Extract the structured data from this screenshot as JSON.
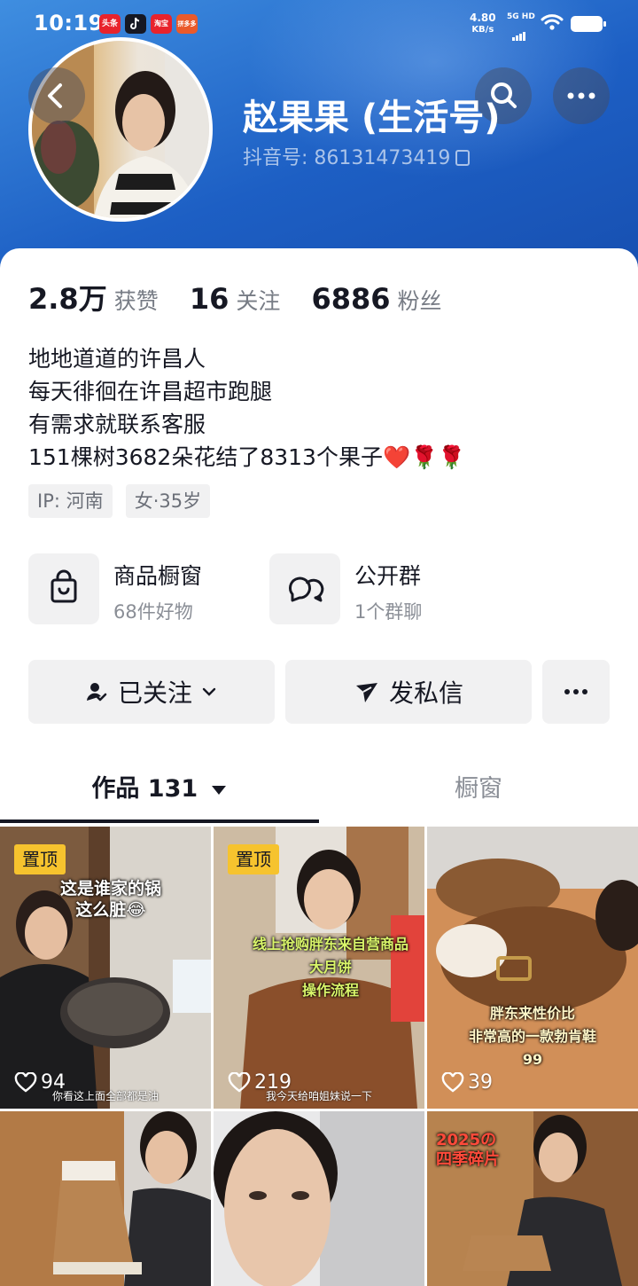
{
  "status_bar": {
    "time": "10:19",
    "apps": [
      "头条",
      "抖音",
      "淘宝",
      "拼多多"
    ],
    "net_speed": "4.80",
    "net_unit": "KB/s",
    "network": "5G HD"
  },
  "profile": {
    "name": "赵果果 (生活号)",
    "douyin_id": "抖音号: 86131473419",
    "stats": [
      {
        "value": "2.8万",
        "label": "获赞"
      },
      {
        "value": "16",
        "label": "关注"
      },
      {
        "value": "6886",
        "label": "粉丝"
      }
    ],
    "bio": [
      "地地道道的许昌人",
      "每天徘徊在许昌超市跑腿",
      "有需求就联系客服",
      "151棵树3682朵花结了8313个果子❤️🌹🌹"
    ],
    "tags": [
      "IP: 河南",
      "女·35岁"
    ]
  },
  "features": [
    {
      "title": "商品橱窗",
      "subtitle": "68件好物",
      "icon": "shopping-bag-icon"
    },
    {
      "title": "公开群",
      "subtitle": "1个群聊",
      "icon": "group-chat-icon"
    }
  ],
  "actions": {
    "follow_label": "已关注",
    "message_label": "发私信"
  },
  "tabs": {
    "works_label": "作品 131",
    "showcase_label": "橱窗"
  },
  "videos": [
    {
      "pinned_label": "置顶",
      "caption": "这是谁家的锅\n这么脏😂",
      "likes": "94",
      "subtitle": "你看这上面全部都是油"
    },
    {
      "pinned_label": "置顶",
      "caption": "线上抢购胖东来自营商品\n大月饼\n操作流程",
      "likes": "219",
      "subtitle": "我今天给咱姐妹说一下"
    },
    {
      "caption": "胖东来性价比\n非常高的一款勃肯鞋\n99",
      "likes": "39"
    },
    {
      "caption": ""
    },
    {
      "caption": ""
    },
    {
      "caption": "2025の\n四季碎片"
    }
  ],
  "colors": {
    "header_blue": "#1d5fc4",
    "pin_yellow": "#f6c32e",
    "heart_red": "#e8232c"
  }
}
